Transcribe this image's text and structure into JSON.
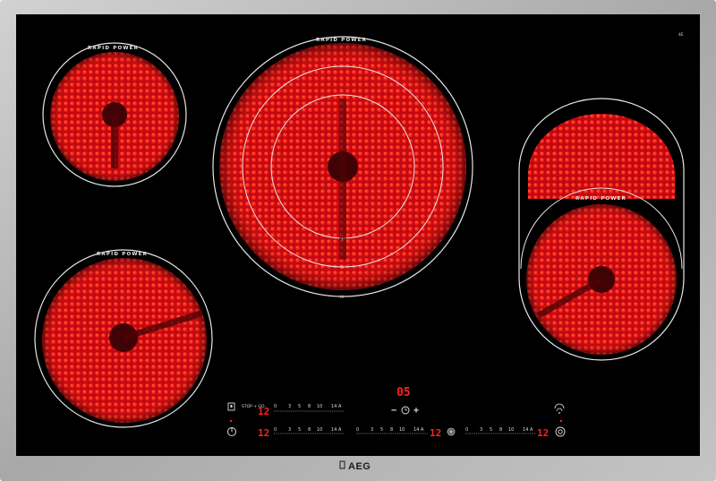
{
  "product": {
    "brand": "AEG",
    "top_right_mark": "4E"
  },
  "zones": {
    "top_left": {
      "label": "RAPID POWER"
    },
    "center": {
      "label": "RAPID POWER",
      "ring_marks": [
        "I",
        "II",
        "III"
      ]
    },
    "bottom_left": {
      "label": "RAPID POWER"
    },
    "right": {
      "label": "RAPID POWER"
    }
  },
  "controls": {
    "timer_display": "05",
    "timer_minus": "−",
    "timer_plus": "+",
    "stop_go_label": "STOP + GO",
    "power_scale": [
      "0",
      "3",
      "5",
      "8",
      "10",
      "14",
      "A"
    ],
    "zone_displays": {
      "top_row_left": "12",
      "bottom_row_left": "12",
      "bottom_row_middle": "12",
      "bottom_row_right": "12"
    }
  },
  "colors": {
    "glass": "#000000",
    "frame": "#b5b5b5",
    "heat": "#e0101a",
    "led": "#ff2020"
  }
}
